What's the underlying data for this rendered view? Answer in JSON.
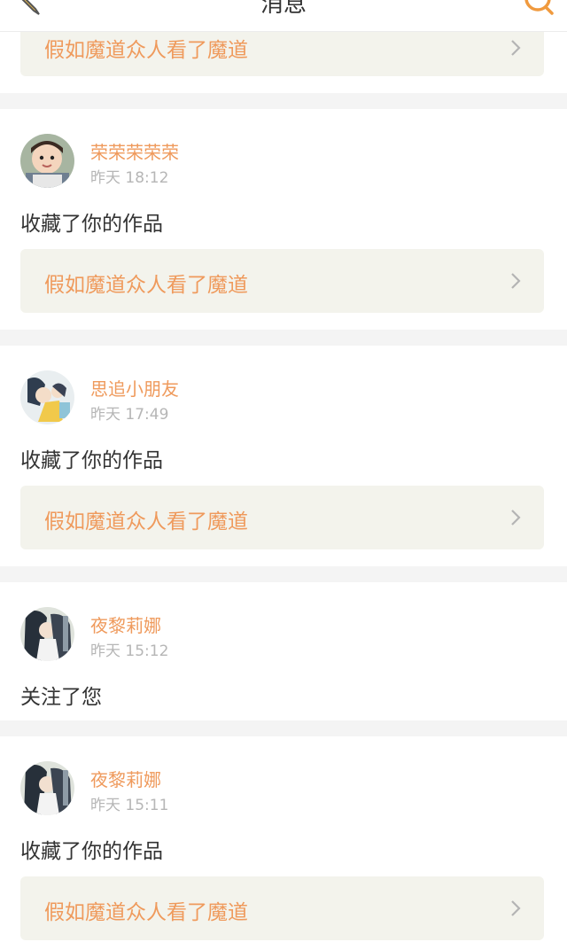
{
  "header": {
    "title": "消息"
  },
  "colors": {
    "accent": "#ef9a5c",
    "work_bg": "#f3f3ec",
    "text": "#333333",
    "muted": "#b6b6b6"
  },
  "feed": {
    "first_card": {
      "work_title": "假如魔道众人看了魔道"
    },
    "items": [
      {
        "username": "荣荣荣荣荣",
        "time": "昨天 18:12",
        "action": "收藏了你的作品",
        "work_title": "假如魔道众人看了魔道"
      },
      {
        "username": "思追小朋友",
        "time": "昨天 17:49",
        "action": "收藏了你的作品",
        "work_title": "假如魔道众人看了魔道"
      },
      {
        "username": "夜黎莉娜",
        "time": "昨天 15:12",
        "action": "关注了您"
      },
      {
        "username": "夜黎莉娜",
        "time": "昨天 15:11",
        "action": "收藏了你的作品",
        "work_title": "假如魔道众人看了魔道"
      }
    ]
  }
}
